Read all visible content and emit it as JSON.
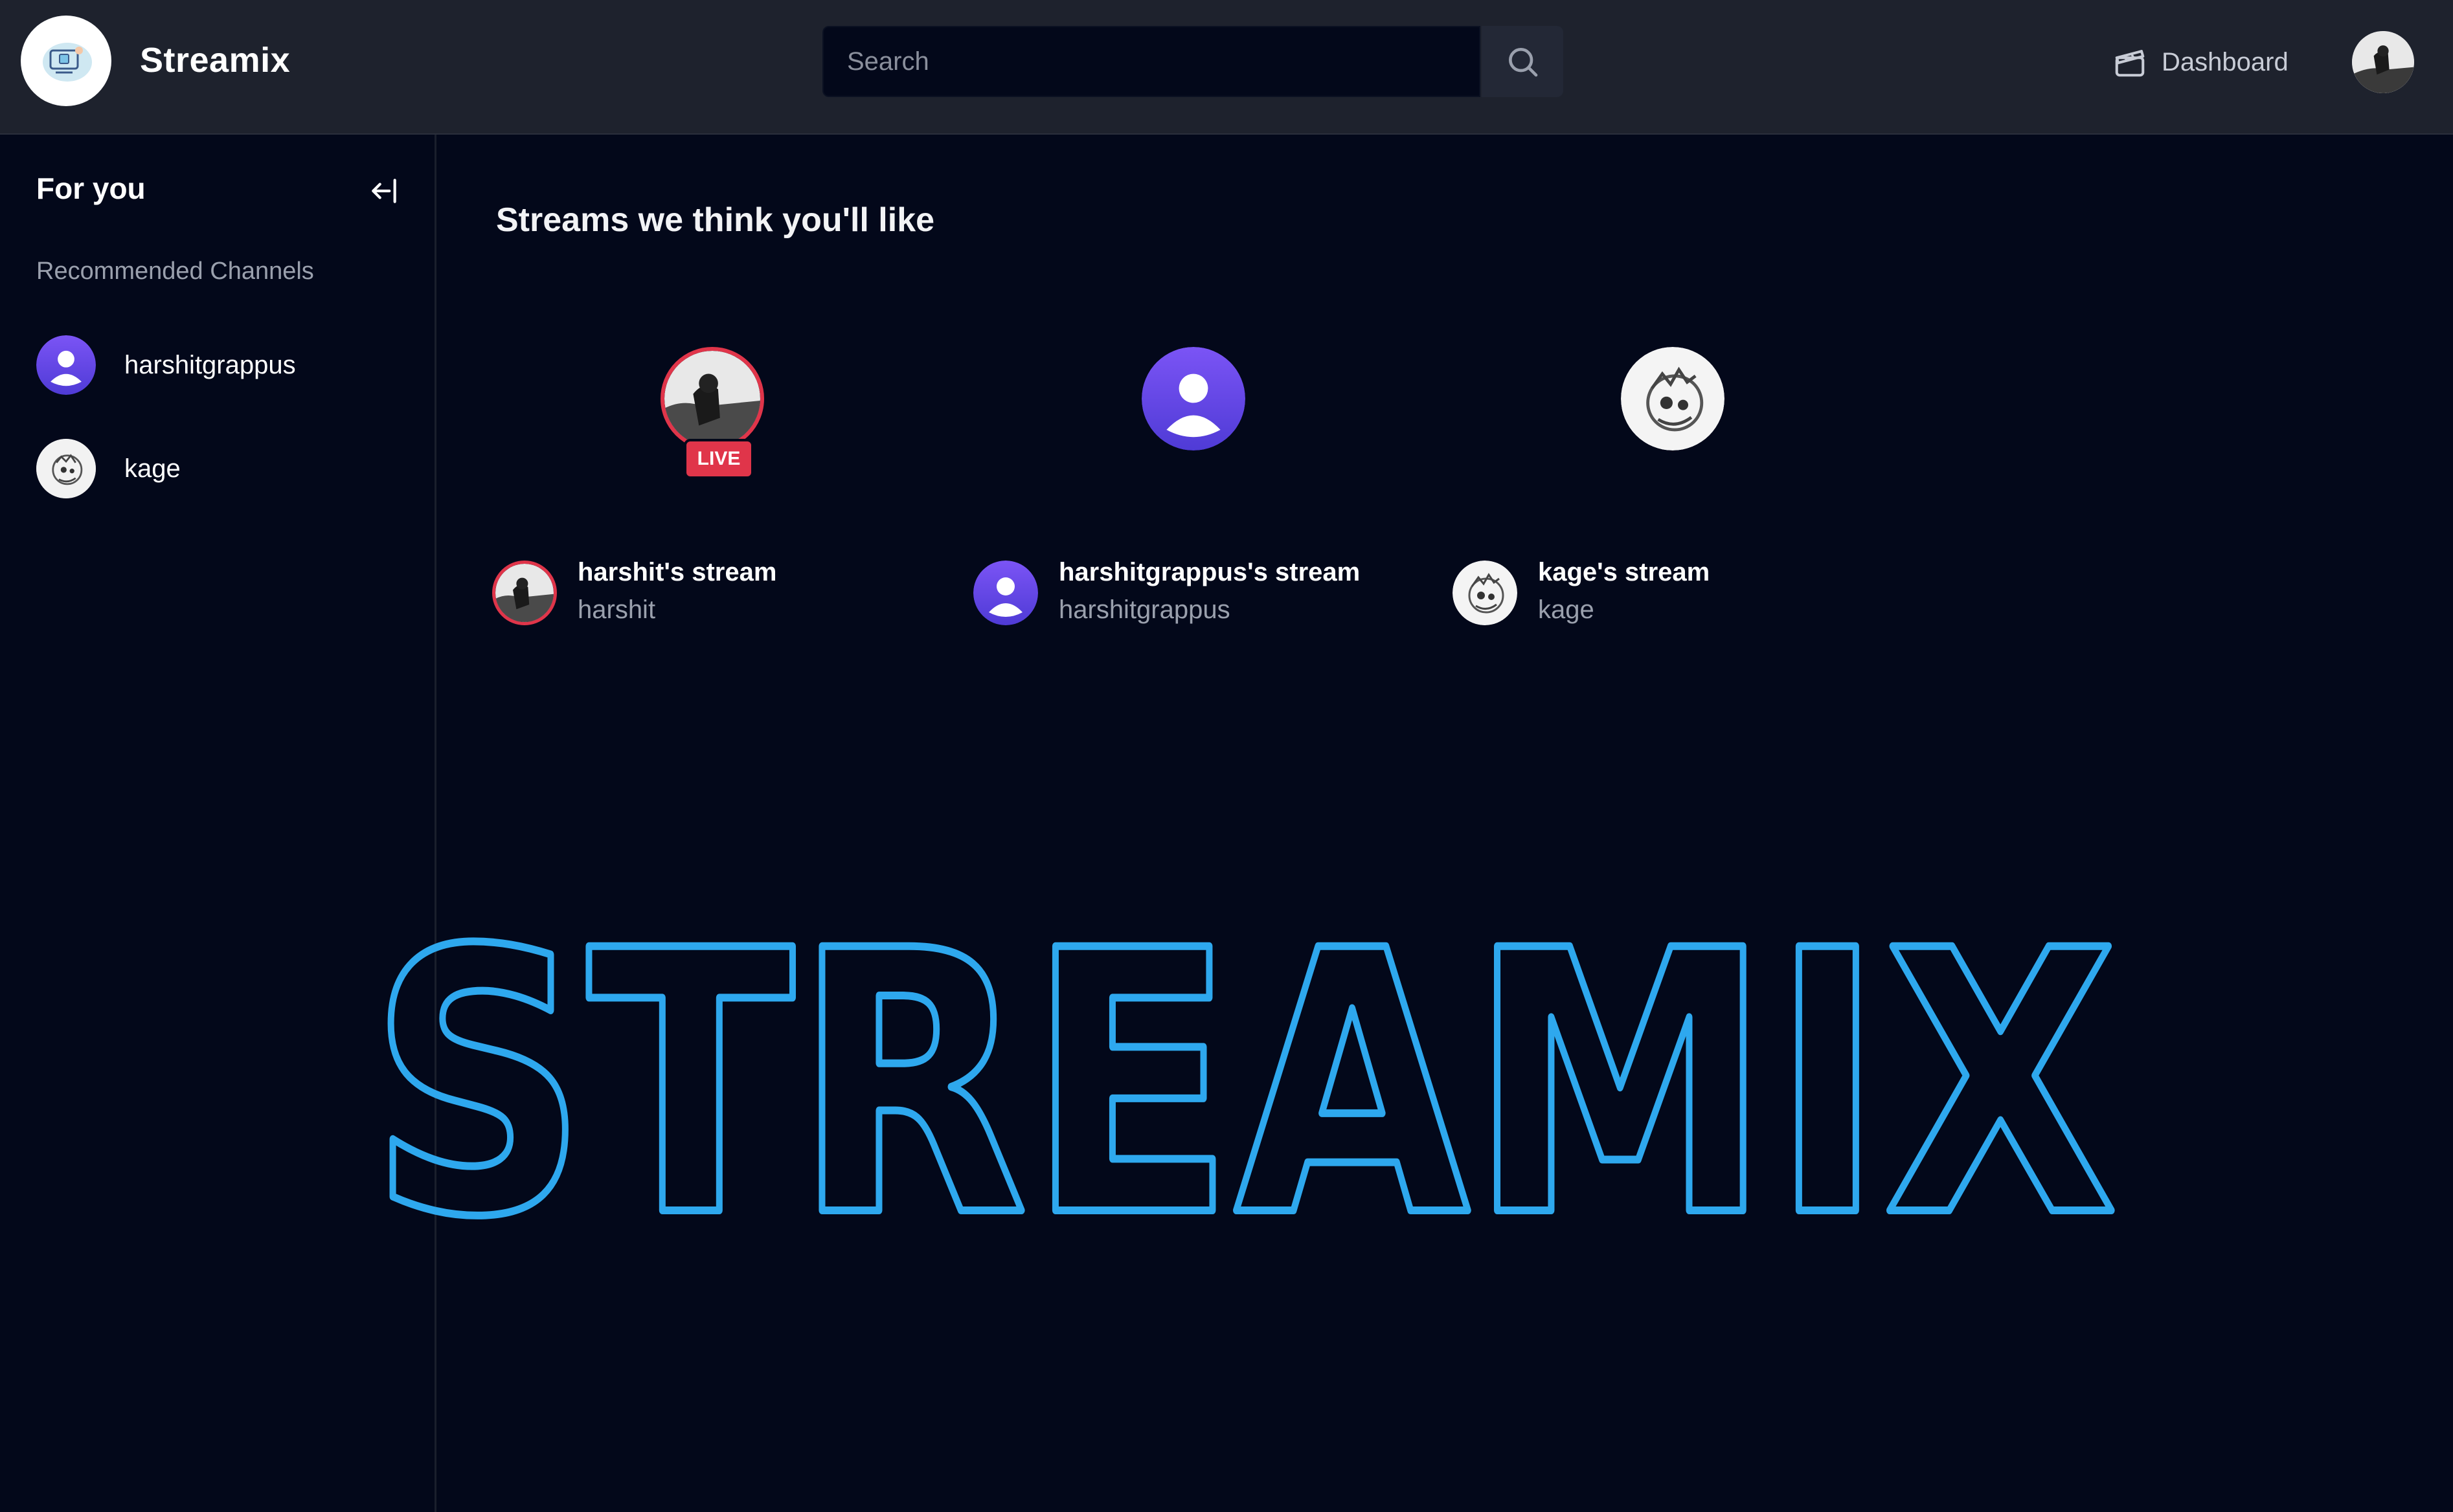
{
  "header": {
    "app_title": "Streamix",
    "search": {
      "placeholder": "Search",
      "value": ""
    },
    "dashboard_label": "Dashboard"
  },
  "sidebar": {
    "title": "For you",
    "section_label": "Recommended Channels",
    "channels": [
      {
        "name": "harshitgrappus",
        "avatar": "purple-default-avatar"
      },
      {
        "name": "kage",
        "avatar": "sketch-photo-avatar"
      }
    ]
  },
  "main": {
    "title": "Streams we think you'll like",
    "streams": [
      {
        "title": "harshit's stream",
        "user": "harshit",
        "live": true,
        "live_label": "LIVE"
      },
      {
        "title": "harshitgrappus's stream",
        "user": "harshitgrappus",
        "live": false
      },
      {
        "title": "kage's stream",
        "user": "kage",
        "live": false
      }
    ]
  },
  "watermark": {
    "text": "STREAMIX",
    "color": "#2ea8ee"
  },
  "colors": {
    "background": "#03081a",
    "topbar": "#1e222d",
    "live": "#e0354a",
    "accent_purple": "#6a4cf0"
  }
}
